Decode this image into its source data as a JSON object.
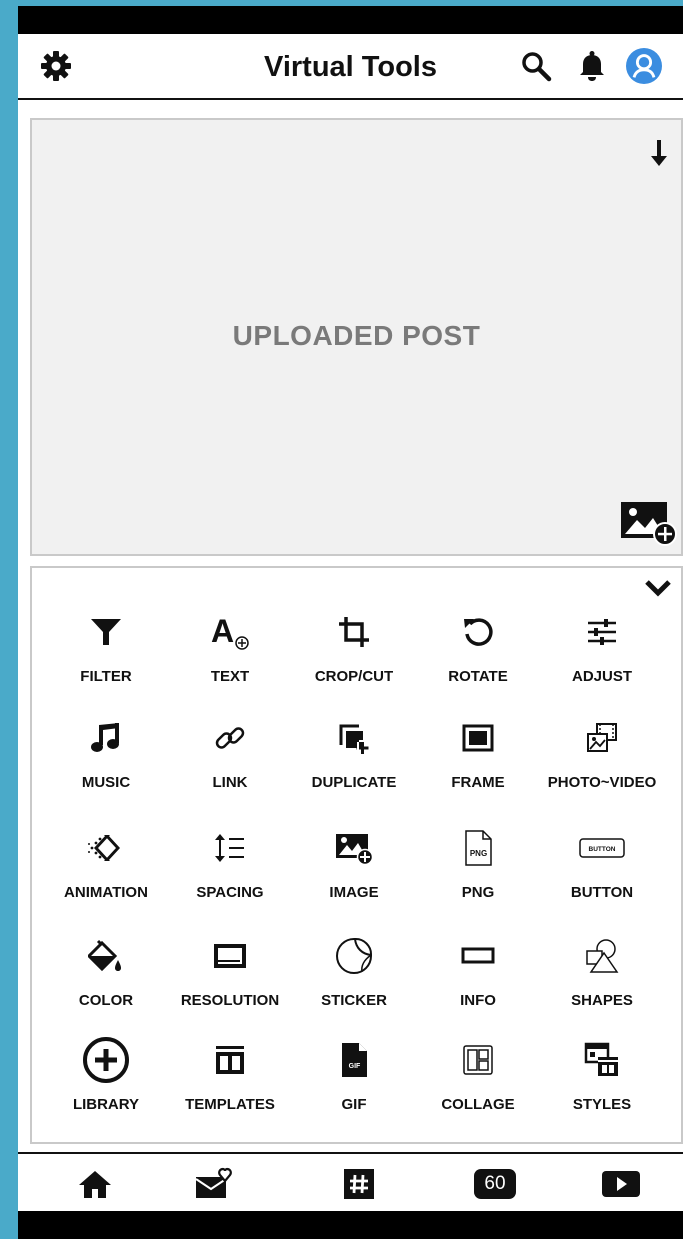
{
  "header": {
    "title": "Virtual Tools",
    "icons": [
      "gear-icon",
      "search-icon",
      "bell-icon",
      "user-avatar-icon"
    ]
  },
  "canvas": {
    "placeholder": "UPLOADED POST",
    "icons": [
      "download-arrow-icon",
      "add-image-icon"
    ]
  },
  "tools": [
    {
      "label": "FILTER",
      "icon": "funnel-icon"
    },
    {
      "label": "TEXT",
      "icon": "text-add-icon"
    },
    {
      "label": "CROP/CUT",
      "icon": "crop-icon"
    },
    {
      "label": "ROTATE",
      "icon": "rotate-icon"
    },
    {
      "label": "ADJUST",
      "icon": "sliders-icon"
    },
    {
      "label": "MUSIC",
      "icon": "music-note-icon"
    },
    {
      "label": "LINK",
      "icon": "link-icon"
    },
    {
      "label": "DUPLICATE",
      "icon": "duplicate-icon"
    },
    {
      "label": "FRAME",
      "icon": "frame-icon"
    },
    {
      "label": "PHOTO~VIDEO",
      "icon": "photo-video-icon"
    },
    {
      "label": "ANIMATION",
      "icon": "animation-icon"
    },
    {
      "label": "SPACING",
      "icon": "line-spacing-icon"
    },
    {
      "label": "IMAGE",
      "icon": "add-image-icon"
    },
    {
      "label": "PNG",
      "icon": "png-file-icon",
      "icon_text": "PNG"
    },
    {
      "label": "BUTTON",
      "icon": "button-icon",
      "icon_text": "BUTTON"
    },
    {
      "label": "COLOR",
      "icon": "paint-bucket-icon"
    },
    {
      "label": "RESOLUTION",
      "icon": "resolution-icon"
    },
    {
      "label": "STICKER",
      "icon": "sticker-icon"
    },
    {
      "label": "INFO",
      "icon": "rectangle-icon"
    },
    {
      "label": "SHAPES",
      "icon": "shapes-icon"
    },
    {
      "label": "LIBRARY",
      "icon": "plus-circle-icon"
    },
    {
      "label": "TEMPLATES",
      "icon": "template-icon"
    },
    {
      "label": "GIF",
      "icon": "gif-file-icon",
      "icon_text": "GIF"
    },
    {
      "label": "COLLAGE",
      "icon": "collage-icon"
    },
    {
      "label": "STYLES",
      "icon": "styles-icon"
    }
  ],
  "bottom_nav": [
    {
      "icon": "home-icon"
    },
    {
      "icon": "mail-heart-icon"
    },
    {
      "icon": "hashtag-icon"
    },
    {
      "icon": "sixty-badge-icon",
      "label": "60"
    },
    {
      "icon": "play-icon"
    }
  ],
  "colors": {
    "background": "#4aaac9",
    "frame": "#000000",
    "canvas": "#f1f1f1",
    "border": "#c9c9c9",
    "avatar": "#3b8de0",
    "placeholder_text": "#7a7a7a"
  }
}
